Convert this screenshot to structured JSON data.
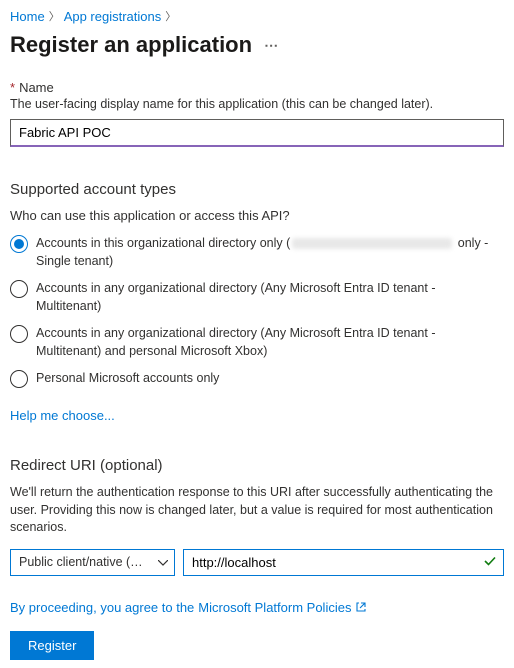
{
  "breadcrumb": {
    "home": "Home",
    "app_reg": "App registrations"
  },
  "page": {
    "title": "Register an application"
  },
  "name_section": {
    "label": "Name",
    "helper": "The user-facing display name for this application (this can be changed later).",
    "value": "Fabric API POC"
  },
  "account_types": {
    "heading": "Supported account types",
    "question": "Who can use this application or access this API?",
    "options": [
      {
        "pre": "Accounts in this organizational directory only (",
        "post": " only - Single tenant)",
        "blurred": true
      },
      {
        "text": "Accounts in any organizational directory (Any Microsoft Entra ID tenant - Multitenant)"
      },
      {
        "text": "Accounts in any organizational directory (Any Microsoft Entra ID tenant - Multitenant) and personal Microsoft Xbox)"
      },
      {
        "text": "Personal Microsoft accounts only"
      }
    ],
    "help_link": "Help me choose..."
  },
  "redirect": {
    "heading": "Redirect URI (optional)",
    "description": "We'll return the authentication response to this URI after successfully authenticating the user. Providing this now is changed later, but a value is required for most authentication scenarios.",
    "platform_selected": "Public client/native (mobile ...",
    "uri_value": "http://localhost"
  },
  "policy": {
    "text_pre": "By proceeding, you agree to the ",
    "link": "Microsoft Platform Policies"
  },
  "actions": {
    "register": "Register"
  }
}
